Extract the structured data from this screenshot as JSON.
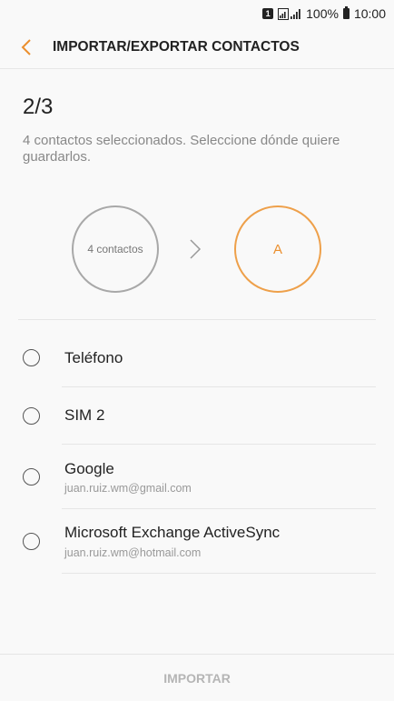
{
  "status_bar": {
    "sim_label": "1",
    "battery_percent": "100%",
    "time": "10:00"
  },
  "app_bar": {
    "title": "IMPORTAR/EXPORTAR CONTACTOS",
    "back_icon": "chevron-left-icon"
  },
  "step": {
    "label": "2/3",
    "description": "4 contactos seleccionados. Seleccione dónde quiere guardarlos."
  },
  "flow": {
    "source_label": "4 contactos",
    "target_label": "A"
  },
  "options": [
    {
      "label": "Teléfono",
      "subtitle": ""
    },
    {
      "label": "SIM 2",
      "subtitle": ""
    },
    {
      "label": "Google",
      "subtitle": "juan.ruiz.wm@gmail.com"
    },
    {
      "label": "Microsoft Exchange ActiveSync",
      "subtitle": "juan.ruiz.wm@hotmail.com"
    }
  ],
  "bottom": {
    "import_label": "IMPORTAR"
  },
  "colors": {
    "accent": "#eb8f2e",
    "background": "#f9f9f9",
    "disabled_text": "#b5b5b5"
  }
}
